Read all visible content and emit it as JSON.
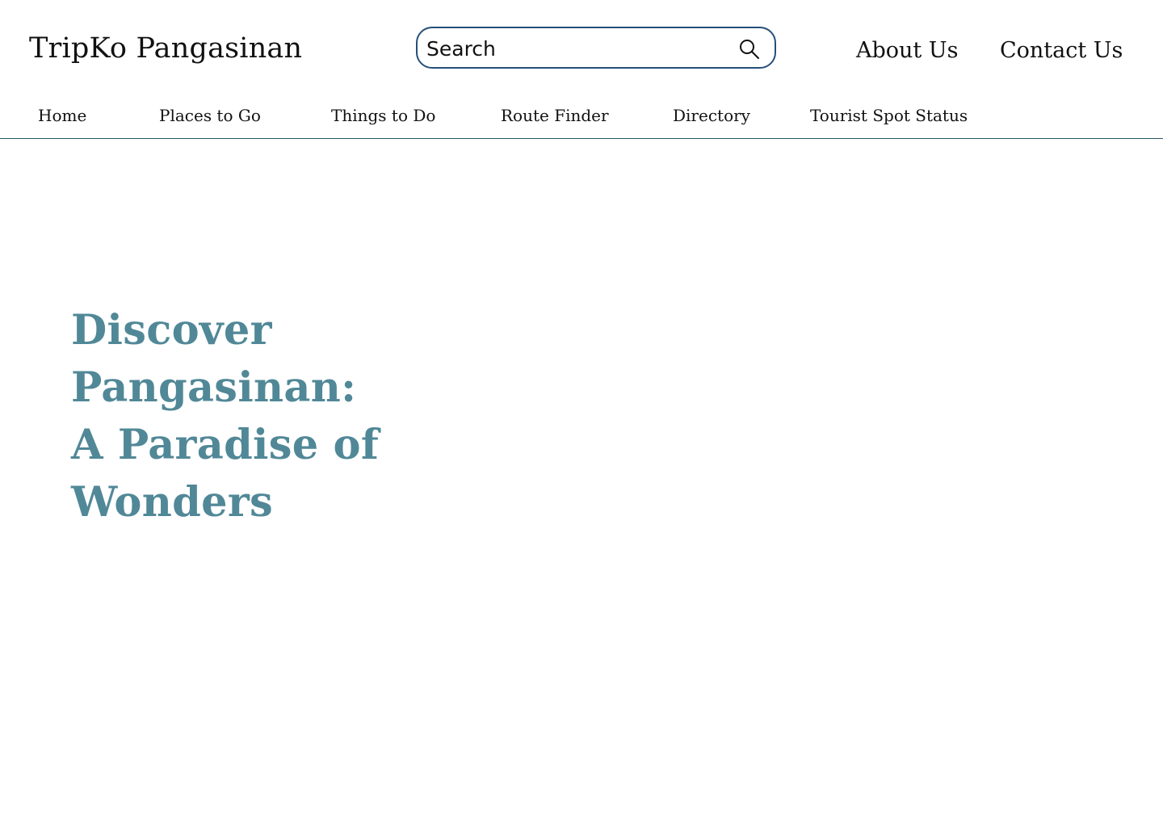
{
  "header": {
    "brand": "TripKo Pangasinan",
    "search": {
      "placeholder": "Search",
      "icon": "search-icon"
    },
    "links": [
      {
        "label": "About Us"
      },
      {
        "label": "Contact Us"
      }
    ]
  },
  "nav": {
    "items": [
      {
        "label": "Home"
      },
      {
        "label": "Places to Go"
      },
      {
        "label": "Things to Do"
      },
      {
        "label": "Route Finder"
      },
      {
        "label": "Directory"
      },
      {
        "label": "Tourist Spot Status"
      }
    ]
  },
  "hero": {
    "title_lines": [
      "Discover",
      "Pangasinan:",
      "A Paradise of",
      "Wonders"
    ]
  },
  "colors": {
    "search_border": "#254f7a",
    "hero_text": "#518897",
    "divider": "#2b5967"
  }
}
